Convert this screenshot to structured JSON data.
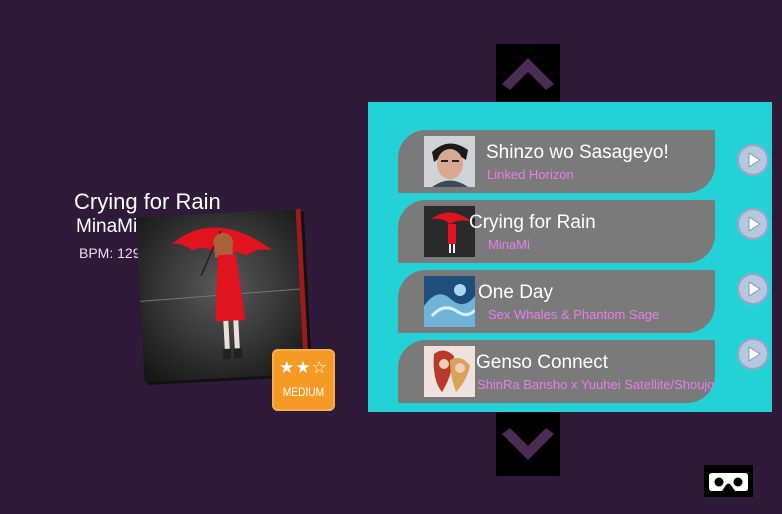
{
  "selected": {
    "title": "Crying for Rain",
    "artist": "MinaMi",
    "bpm": "BPM: 129",
    "difficulty_label": "MEDIUM",
    "difficulty_stars": "★★☆",
    "difficulty_rating": "2 of 3"
  },
  "songs": [
    {
      "title": "Shinzo wo Sasageyo!",
      "artist": "Linked Horizon"
    },
    {
      "title": "Crying for Rain",
      "artist": "MinaMi"
    },
    {
      "title": "One Day",
      "artist": "Sex Whales & Phantom Sage"
    },
    {
      "title": "Genso Connect",
      "artist": "ShinRa Bansho x Yuuhei Satellite/Shoujo"
    }
  ],
  "icons": {
    "scroll_up": "chevron-up-icon",
    "scroll_down": "chevron-down-icon",
    "play": "play-icon",
    "vr": "vr-headset-icon"
  },
  "colors": {
    "background": "#2f1b39",
    "panel": "#22d2d6",
    "row": "#7a7a7a",
    "artist_text": "#e57ee8",
    "difficulty_badge": "#f59a24",
    "arrow": "#4a2d55",
    "play_button": "#b6c7de"
  }
}
